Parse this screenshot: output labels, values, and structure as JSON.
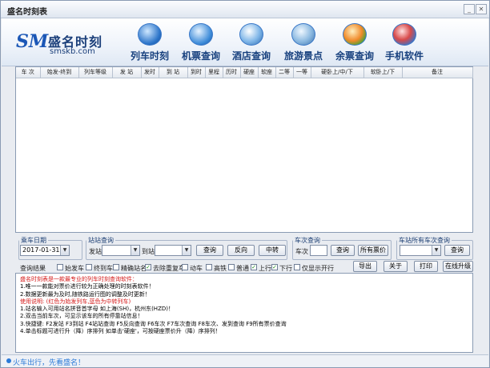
{
  "window": {
    "title": "盛名时刻表"
  },
  "logo": {
    "name": "盛名时刻",
    "url": "smskb.com",
    "mark": "SM"
  },
  "nav": [
    {
      "label": "列车时刻",
      "icon": "train-icon"
    },
    {
      "label": "机票查询",
      "icon": "plane-icon"
    },
    {
      "label": "酒店查询",
      "icon": "hotel-icon"
    },
    {
      "label": "旅游景点",
      "icon": "travel-icon"
    },
    {
      "label": "余票查询",
      "icon": "ticket-icon"
    },
    {
      "label": "手机软件",
      "icon": "mobile-icon"
    }
  ],
  "table": {
    "columns": [
      "车 次",
      "始发-终到",
      "列车等级",
      "发 站",
      "发时",
      "到 站",
      "到时",
      "里程",
      "历时",
      "硬座",
      "软座",
      "二等",
      "一等",
      "硬卧上/中/下",
      "软卧上/下",
      "备注"
    ]
  },
  "query": {
    "date_legend": "乘车日期",
    "date_value": "2017-01-31",
    "station_legend": "站站查询",
    "from_label": "发站",
    "to_label": "到站",
    "query_btn": "查询",
    "reverse_btn": "反向",
    "transfer_btn": "中转",
    "train_legend": "车次查询",
    "train_label": "车次",
    "train_query_btn": "查询",
    "all_price_btn": "所有票价",
    "station_all_legend": "车站所有车次查询",
    "station_query_btn": "查询"
  },
  "filters": {
    "result_label": "查询结果",
    "items": [
      {
        "label": "始发车",
        "checked": false
      },
      {
        "label": "终到车",
        "checked": false
      },
      {
        "label": "精确站名",
        "checked": false
      },
      {
        "label": "去除重复车",
        "checked": true
      },
      {
        "label": "动车",
        "checked": false
      },
      {
        "label": "高铁",
        "checked": false
      },
      {
        "label": "普通",
        "checked": false
      },
      {
        "label": "上行",
        "checked": true
      },
      {
        "label": "下行",
        "checked": true
      },
      {
        "label": "仅显示开行",
        "checked": false
      }
    ],
    "check_mark": "✓",
    "export_btn": "导出",
    "about_btn": "关于",
    "print_btn": "打印",
    "upgrade_btn": "在线升级"
  },
  "info": [
    "盛名时刻表是一款最专业的列车时刻查询软件：",
    "1.唯一一款能对票价进行较为正确处理的时刻表软件！",
    "2.数据更新最为及时,随铁路运行图的调整及时更新！",
    "使用说明: (红色为始发列车,蓝色为中转列车)",
    "1.站名输入可用站名拼音首字母 如上海(SH)，杭州东(HZD)！",
    "2.双击当前车次，可显示该车的所有停靠站信息！",
    "3.快捷键: F2发站 F3到站 F4站站查询 F5反向查询 F6车次 F7车次查询 F8车次、发到查询 F9所有票价查询",
    "4.单击标题可进行升（降）序排列 如单击'硬座'，可按硬座票价升（降）序排列！"
  ],
  "status": {
    "text": "火车出行，先看盛名！"
  },
  "colors": {
    "accent": "#1b57b6",
    "info_red": "#d41a1a",
    "info_blue": "#1a3fb0",
    "status_text": "#2a7ad8"
  }
}
